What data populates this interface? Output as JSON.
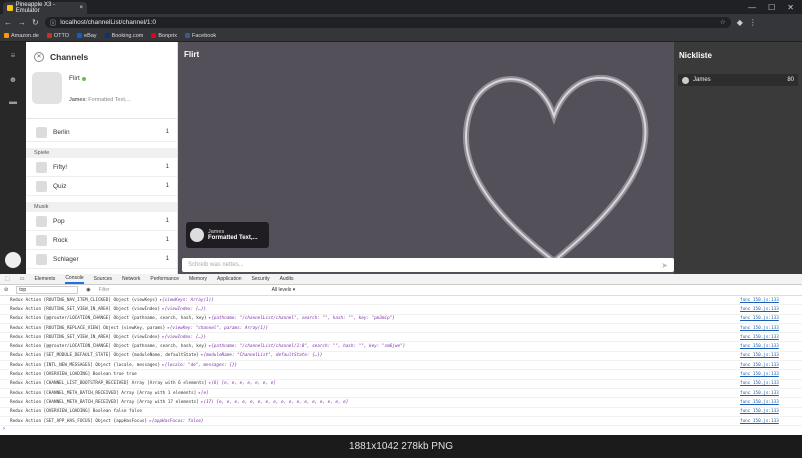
{
  "browser": {
    "tab_title": "Pineapple X3 - Emulator",
    "tab_close": "×",
    "url": "localhost/channelList/channel/1:0",
    "window_controls": [
      "—",
      "☐",
      "✕"
    ],
    "bookmarks": [
      {
        "label": "Amazon.de",
        "color": "#ff9900"
      },
      {
        "label": "OTTO",
        "color": "#d52b1e"
      },
      {
        "label": "eBay",
        "color": "#0064d2"
      },
      {
        "label": "Booking.com",
        "color": "#003580"
      },
      {
        "label": "Bonprix",
        "color": "#e2001a"
      },
      {
        "label": "Facebook",
        "color": "#3b5998"
      }
    ]
  },
  "channels": {
    "title": "Channels",
    "current": {
      "name": "Flirt",
      "last_sender": "James:",
      "last_text": "Formatted Text,..."
    },
    "top_items": [
      {
        "label": "Berlin",
        "count": "1"
      }
    ],
    "categories": [
      {
        "name": "Spiele",
        "items": [
          {
            "label": "Fifty!",
            "count": "1"
          },
          {
            "label": "Quiz",
            "count": "1"
          }
        ]
      },
      {
        "name": "Musik",
        "items": [
          {
            "label": "Pop",
            "count": "1"
          },
          {
            "label": "Rock",
            "count": "1"
          },
          {
            "label": "Schlager",
            "count": "1"
          }
        ]
      }
    ]
  },
  "chat": {
    "title": "Flirt",
    "message": {
      "sender": "James",
      "text": "Formatted Text,..."
    },
    "input_placeholder": "Schreib was nettes...",
    "send_icon": "➤"
  },
  "nicklist": {
    "title": "Nickliste",
    "users": [
      {
        "name": "James",
        "count": "80"
      }
    ]
  },
  "devtools": {
    "tabs": [
      "Elements",
      "Console",
      "Sources",
      "Network",
      "Performance",
      "Memory",
      "Application",
      "Security",
      "Audits"
    ],
    "active_tab": "Console",
    "context": "top",
    "filter_placeholder": "Filter",
    "levels": "All levels ▾",
    "logs": [
      {
        "text": "Redux Action [ROUTING_NAV_ITEM_CLICKED] Object {viewKeys}",
        "detail": "▸{viewKeys: Array(1)}",
        "src": "func 150.js:133"
      },
      {
        "text": "Redux Action [ROUTING_SET_VIEW_IN_AREA] Object {viewIndex}",
        "detail": "▸{viewIndex: {…}}",
        "src": "func 150.js:133"
      },
      {
        "text": "Redux Action [@@router/LOCATION_CHANGE] Object {pathname, search, hash, key}",
        "detail": "▸{pathname: \"/channelList/channel\", search: \"\", hash: \"\", key: \"pm3mip\"}",
        "src": "func 150.js:133"
      },
      {
        "text": "Redux Action [ROUTING_REPLACE_VIEW] Object {viewKey, params}",
        "detail": "▸{viewKey: \"channel\", params: Array(1)}",
        "src": "func 150.js:133"
      },
      {
        "text": "Redux Action [ROUTING_SET_VIEW_IN_AREA] Object {viewIndex}",
        "detail": "▸{viewIndex: {…}}",
        "src": "func 150.js:133"
      },
      {
        "text": "Redux Action [@@router/LOCATION_CHANGE] Object {pathname, search, hash, key}",
        "detail": "▸{pathname: \"/channelList/channel/1:0\", search: \"\", hash: \"\", key: \"sm6jwe\"}",
        "src": "func 150.js:133"
      },
      {
        "text": "Redux Action [SET_MODULE_DEFAULT_STATE] Object {moduleName, defaultState}",
        "detail": "▸{moduleName: \"ChannelList\", defaultState: {…}}",
        "src": "func 150.js:133"
      },
      {
        "text": "Redux Action [INTL_NEW_MESSAGES] Object {locale, messages}",
        "detail": "▸{locale: \"de\", messages: {}}",
        "src": "func 150.js:133"
      },
      {
        "text": "Redux Action [OVERVIEW_LOADING] Boolean true true",
        "detail": "",
        "src": "func 150.js:133"
      },
      {
        "text": "Redux Action [CHANNEL_LIST_BOOTSTRAP_RECEIVED] Array [Array with 6 elements]",
        "detail": "▸(6) [e, e, e, e, e, e, e]",
        "src": "func 150.js:133"
      },
      {
        "text": "Redux Action [CHANNEL_META_BATCH_RECEIVED] Array [Array with 1 elements]",
        "detail": "▸[e]",
        "src": "func 150.js:133"
      },
      {
        "text": "Redux Action [CHANNEL_META_BATCH_RECEIVED] Array [Array with 17 elements]",
        "detail": "▸(17) [e, e, e, e, e, e, e, e, e, e, e, e, e, e, e, e, e]",
        "src": "func 150.js:133"
      },
      {
        "text": "Redux Action [OVERVIEW_LOADING] Boolean false false",
        "detail": "",
        "src": "func 150.js:133"
      },
      {
        "text": "Redux Action [SET_APP_HAS_FOCUS] Object {appHasFocus}",
        "detail": "▸{appHasFocus: false}",
        "src": "func 150.js:133"
      }
    ]
  },
  "caption": "1881x1042  278kb  PNG"
}
